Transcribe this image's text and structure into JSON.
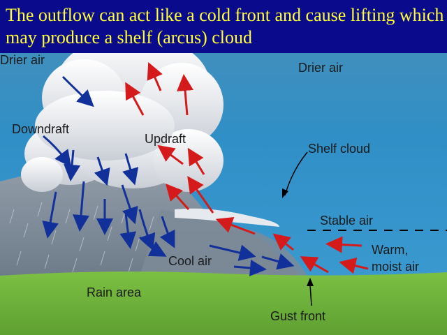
{
  "title": "The outflow can act like a cold front and cause lifting which may produce a shelf (arcus) cloud",
  "labels": {
    "drier_air_left": "Drier air",
    "drier_air_right": "Drier air",
    "downdraft": "Downdraft",
    "updraft": "Updraft",
    "shelf_cloud": "Shelf cloud",
    "stable_air": "Stable air",
    "warm_moist_air_line1": "Warm,",
    "warm_moist_air_line2": "moist air",
    "cool_air": "Cool air",
    "rain_area": "Rain area",
    "gust_front": "Gust front"
  },
  "colors": {
    "title_bar": "#0a0a8c",
    "title_text": "#ffff33",
    "sky": "#2f8fc6",
    "ground": "#6fb43c",
    "updraft_arrow": "#d41a1a",
    "downdraft_arrow": "#12309a"
  }
}
